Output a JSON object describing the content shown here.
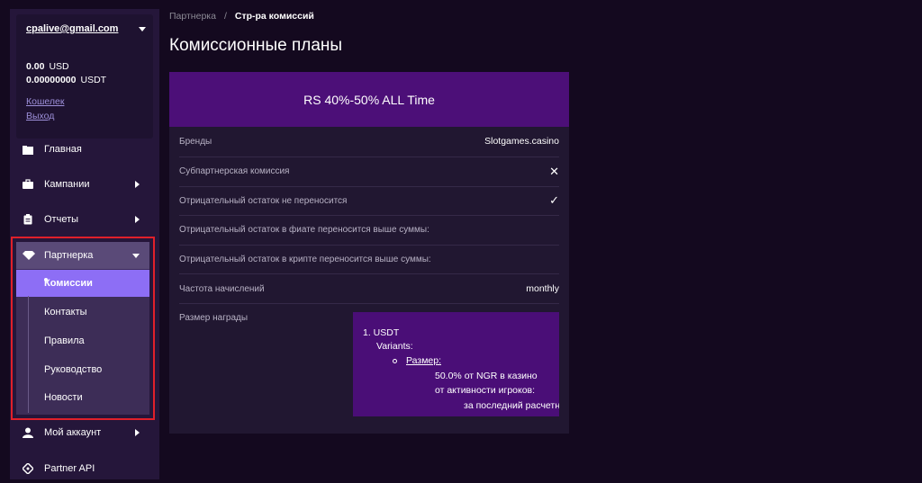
{
  "account": {
    "email": "cpalive@gmail.com",
    "balances": [
      {
        "amount": "0.00",
        "currency": "USD"
      },
      {
        "amount": "0.00000000",
        "currency": "USDT"
      }
    ],
    "wallet_link": "Кошелек",
    "logout_link": "Выход"
  },
  "nav": {
    "home": "Главная",
    "campaigns": "Кампании",
    "reports": "Отчеты",
    "partner": "Партнерка",
    "partner_sub": {
      "commissions": "Комиссии",
      "contacts": "Контакты",
      "rules": "Правила",
      "guide": "Руководство",
      "news": "Новости"
    },
    "my_account": "Мой аккаунт",
    "partner_api": "Partner API"
  },
  "breadcrumb": {
    "parent": "Партнерка",
    "separator": "/",
    "current": "Стр-ра комиссий"
  },
  "page_title": "Комиссионные планы",
  "plan": {
    "title": "RS 40%-50% ALL Time",
    "rows": [
      {
        "label": "Бренды",
        "value": "Slotgames.casino"
      },
      {
        "label": "Субпартнерская комиссия",
        "value": "✕"
      },
      {
        "label": "Отрицательный остаток не переносится",
        "value": "✓"
      },
      {
        "label": "Отрицательный остаток в фиате переносится выше суммы:",
        "value": ""
      },
      {
        "label": "Отрицательный остаток в крипте переносится выше суммы:",
        "value": ""
      },
      {
        "label": "Частота начислений",
        "value": "monthly"
      },
      {
        "label": "Размер награды",
        "value": ""
      }
    ],
    "reward": {
      "line1": "1. USDT",
      "line2": "Variants:",
      "line3": "Размер:",
      "line4": "50.0% от NGR в казино",
      "line5": "от активности игроков:",
      "line6": "за последний расчетн"
    }
  },
  "colors": {
    "sidebar_bg": "#25163a",
    "active_sub": "#8d6ef5",
    "plan_header": "#4c0f78",
    "highlight_frame": "#e0202a"
  }
}
